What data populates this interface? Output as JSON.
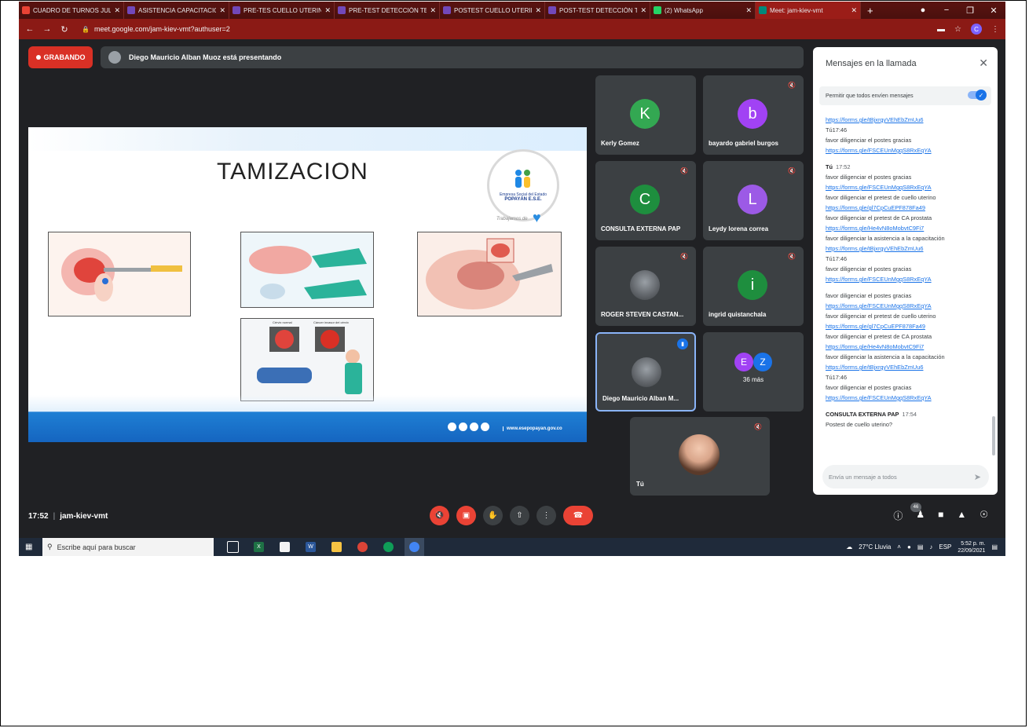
{
  "browser": {
    "tabs": [
      {
        "label": "CUADRO DE TURNOS JULI",
        "icon": "gmail-icon",
        "color": "#ea4335"
      },
      {
        "label": "ASISTENCIA CAPACITACIO",
        "icon": "forms-icon",
        "color": "#7248b9"
      },
      {
        "label": "PRE-TES CUELLO UTERINO",
        "icon": "forms-icon",
        "color": "#7248b9"
      },
      {
        "label": "PRE-TEST DETECCIÓN TEM",
        "icon": "forms-icon",
        "color": "#7248b9"
      },
      {
        "label": "POSTEST CUELLO UTERINO",
        "icon": "forms-icon",
        "color": "#7248b9"
      },
      {
        "label": "POST-TEST DETECCIÓN TE",
        "icon": "forms-icon",
        "color": "#7248b9"
      },
      {
        "label": "(2) WhatsApp",
        "icon": "whatsapp-icon",
        "color": "#25d366"
      },
      {
        "label": "Meet: jam-kiev-vmt",
        "icon": "meet-icon",
        "color": "#00897b"
      }
    ],
    "url": "meet.google.com/jam-kiev-vmt?authuser=2",
    "profile_initial": "C"
  },
  "meet": {
    "recording_label": "GRABANDO",
    "presenting_text": "Diego Mauricio Alban Muoz está presentando",
    "meeting_time": "17:52",
    "meeting_code": "jam-kiev-vmt",
    "participant_count": "46"
  },
  "slide": {
    "title": "TAMIZACION",
    "logo_line1": "Empresa Social del Estado",
    "logo_line2": "POPAYÁN E.S.E.",
    "tagline": "Trabajamos de",
    "website": "www.esepopayan.gov.co",
    "illustration_caption_1": "Cérvix normal",
    "illustration_caption_2": "Cáncer invasor del cérvix"
  },
  "participants": [
    {
      "name": "Kerly Gomez",
      "initial": "K",
      "color": "#33a852",
      "muted": false
    },
    {
      "name": "bayardo gabriel burgos",
      "initial": "b",
      "color": "#a142f4",
      "muted": true
    },
    {
      "name": "CONSULTA EXTERNA PAP",
      "initial": "C",
      "color": "#1e8e3e",
      "muted": true
    },
    {
      "name": "Leydy lorena correa",
      "initial": "L",
      "color": "#9c5ae6",
      "muted": true
    },
    {
      "name": "ROGER STEVEN CASTAN...",
      "initial": "",
      "color": "#5f6368",
      "muted": true
    },
    {
      "name": "ingrid quistanchala",
      "initial": "i",
      "color": "#1e8e3e",
      "muted": true
    },
    {
      "name": "Diego Mauricio Alban M...",
      "initial": "",
      "color": "#5f6368",
      "muted": false
    },
    {
      "name": "36 más",
      "initial": "",
      "color": "#3c4043",
      "muted": false
    },
    {
      "name": "Tú",
      "initial": "",
      "color": "#3c4043",
      "muted": true
    }
  ],
  "more_avatars": [
    "E",
    "Z"
  ],
  "chat": {
    "title": "Mensajes en la llamada",
    "permission_label": "Permitir que todos envíen mensajes",
    "input_placeholder": "Envía un mensaje a todos",
    "lines": [
      {
        "t": "https://forms.gle/tBjxrgyVEhEbZmUu6",
        "k": "link"
      },
      {
        "t": "Tú17:46",
        "k": "text"
      },
      {
        "t": "favor diligenciar el postes gracias",
        "k": "text"
      },
      {
        "t": "https://forms.gle/FSCEUnMgqS8RxEqYA",
        "k": "link"
      },
      {
        "t": "",
        "k": "gap"
      },
      {
        "t": "Tú",
        "k": "hdr",
        "time": "17:52"
      },
      {
        "t": "favor diligenciar el postes gracias",
        "k": "text"
      },
      {
        "t": "https://forms.gle/FSCEUnMgqS8RxEqYA",
        "k": "link"
      },
      {
        "t": "favor diligenciar el pretest de cuello uterino",
        "k": "text"
      },
      {
        "t": "https://forms.gle/gl7CpCuEPF878Fa49",
        "k": "link"
      },
      {
        "t": "favor diligenciar el pretest de CA prostata",
        "k": "text"
      },
      {
        "t": "https://forms.gle/He4vN8oMobvtC9Fi7",
        "k": "link"
      },
      {
        "t": "favor diligenciar la asistencia a la capacitación",
        "k": "text"
      },
      {
        "t": "https://forms.gle/tBjxrgyVEhEbZmUu6",
        "k": "link"
      },
      {
        "t": "Tú17:46",
        "k": "text"
      },
      {
        "t": "favor diligenciar el postes gracias",
        "k": "text"
      },
      {
        "t": "https://forms.gle/FSCEUnMgqS8RxEqYA",
        "k": "link"
      },
      {
        "t": "",
        "k": "gap"
      },
      {
        "t": "favor diligenciar el postes gracias",
        "k": "text"
      },
      {
        "t": "https://forms.gle/FSCEUnMgqS8RxEqYA",
        "k": "link"
      },
      {
        "t": "favor diligenciar el pretest de cuello uterino",
        "k": "text"
      },
      {
        "t": "https://forms.gle/gl7CpCuEPF878Fa49",
        "k": "link"
      },
      {
        "t": "favor diligenciar el pretest de CA prostata",
        "k": "text"
      },
      {
        "t": "https://forms.gle/He4vN8oMobvtC9Fi7",
        "k": "link"
      },
      {
        "t": "favor diligenciar la asistencia a la capacitación",
        "k": "text"
      },
      {
        "t": "https://forms.gle/tBjxrgyVEhEbZmUu6",
        "k": "link"
      },
      {
        "t": "Tú17:46",
        "k": "text"
      },
      {
        "t": "favor diligenciar el postes gracias",
        "k": "text"
      },
      {
        "t": "https://forms.gle/FSCEUnMgqS8RxEqYA",
        "k": "link"
      },
      {
        "t": "",
        "k": "gap"
      },
      {
        "t": "CONSULTA EXTERNA PAP",
        "k": "hdr",
        "time": "17:54"
      },
      {
        "t": "Postest de cuello uterino?",
        "k": "text"
      }
    ]
  },
  "taskbar": {
    "search_placeholder": "Escribe aquí para buscar",
    "weather": "27°C Lluvia",
    "lang": "ESP",
    "time": "5:52 p. m.",
    "date": "22/09/2021"
  }
}
